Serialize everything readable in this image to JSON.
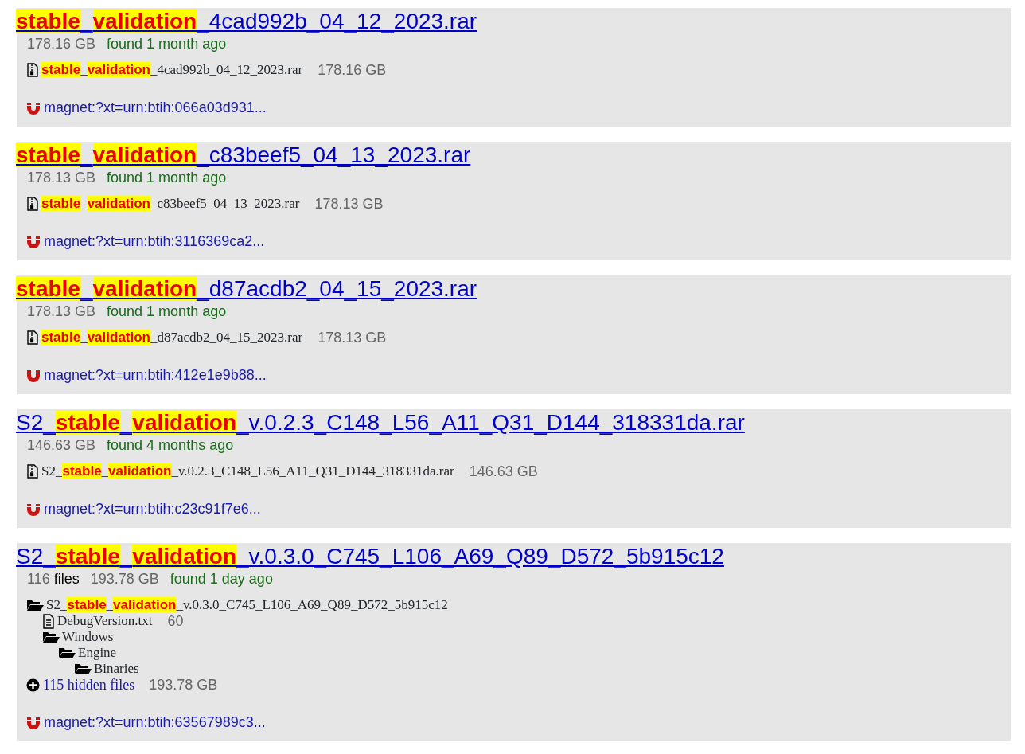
{
  "results": [
    {
      "title": "**stable**_**validation**_4cad992b_04_12_2023.rar",
      "size": "178.16 GB",
      "found": "found 1 month ago",
      "tree": [
        {
          "kind": "archive",
          "name": "**stable**_**validation**_4cad992b_04_12_2023.rar",
          "size": "178.16 GB"
        }
      ],
      "magnet": "magnet:?xt=urn:btih:066a03d931..."
    },
    {
      "title": "**stable**_**validation**_c83beef5_04_13_2023.rar",
      "size": "178.13 GB",
      "found": "found 1 month ago",
      "tree": [
        {
          "kind": "archive",
          "name": "**stable**_**validation**_c83beef5_04_13_2023.rar",
          "size": "178.13 GB"
        }
      ],
      "magnet": "magnet:?xt=urn:btih:3116369ca2..."
    },
    {
      "title": "**stable**_**validation**_d87acdb2_04_15_2023.rar",
      "size": "178.13 GB",
      "found": "found 1 month ago",
      "tree": [
        {
          "kind": "archive",
          "name": "**stable**_**validation**_d87acdb2_04_15_2023.rar",
          "size": "178.13 GB"
        }
      ],
      "magnet": "magnet:?xt=urn:btih:412e1e9b88..."
    },
    {
      "title": "S2_**stable**_**validation**_v.0.2.3_C148_L56_A11_Q31_D144_318331da.rar",
      "size": "146.63 GB",
      "found": "found 4 months ago",
      "tree": [
        {
          "kind": "archive",
          "name": "S2_**stable**_**validation**_v.0.2.3_C148_L56_A11_Q31_D144_318331da.rar",
          "size": "146.63 GB"
        }
      ],
      "magnet": "magnet:?xt=urn:btih:c23c91f7e6..."
    },
    {
      "title": "S2_**stable**_**validation**_v.0.3.0_C745_L106_A69_Q89_D572_5b915c12",
      "files": {
        "count": "116",
        "label": "files"
      },
      "size": "193.78 GB",
      "found": "found 1 day ago",
      "tree": [
        {
          "kind": "folder",
          "name": "S2_**stable**_**validation**_v.0.3.0_C745_L106_A69_Q89_D572_5b915c12",
          "children": [
            {
              "kind": "file",
              "name": "DebugVersion.txt",
              "size": "60"
            },
            {
              "kind": "folder",
              "name": "Windows",
              "children": [
                {
                  "kind": "folder",
                  "name": "Engine",
                  "children": [
                    {
                      "kind": "folder",
                      "name": "Binaries"
                    }
                  ]
                }
              ]
            }
          ]
        }
      ],
      "hidden": {
        "text": "115 hidden files",
        "size": "193.78 GB"
      },
      "magnet": "magnet:?xt=urn:btih:63567989c3..."
    }
  ]
}
